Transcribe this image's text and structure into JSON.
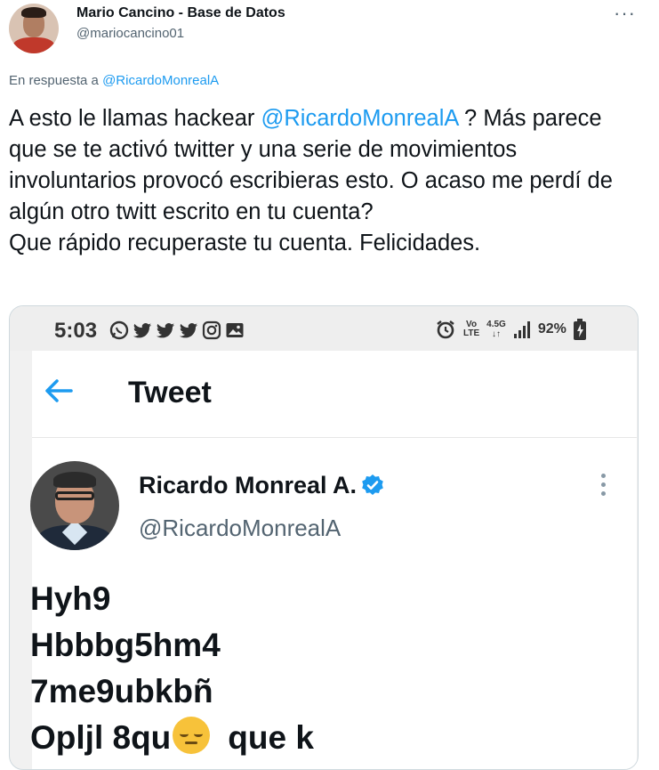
{
  "author": {
    "name": "Mario Cancino - Base de Datos",
    "handle": "@mariocancino01"
  },
  "reply": {
    "prefix": "En respuesta a ",
    "mention": "@RicardoMonrealA"
  },
  "tweet": {
    "part1": "A esto le llamas hackear ",
    "mention": "@RicardoMonrealA",
    "part2": " ? Más parece que se te activó twitter y una serie de movimientos involuntarios provocó escribieras esto. O acaso me perdí de algún otro twitt escrito en tu cuenta?\nQue rápido recuperaste tu cuenta. Felicidades."
  },
  "screenshot": {
    "status_bar": {
      "time": "5:03",
      "network_top": "Vo",
      "network_bottom": "LTE",
      "signal_label": "4.5G",
      "battery": "92%"
    },
    "header": {
      "title": "Tweet"
    },
    "embedded_tweet": {
      "name": "Ricardo Monreal A.",
      "handle": "@RicardoMonrealA",
      "lines": [
        "Hyh9",
        "Hbbbg5hm4",
        "7me9ubkbñ",
        "Opljl 8qu",
        "que k"
      ]
    },
    "colors": {
      "accent": "#1d9bf0",
      "verified": "#1d9bf0",
      "status_bar_bg": "#eeeeee"
    }
  }
}
